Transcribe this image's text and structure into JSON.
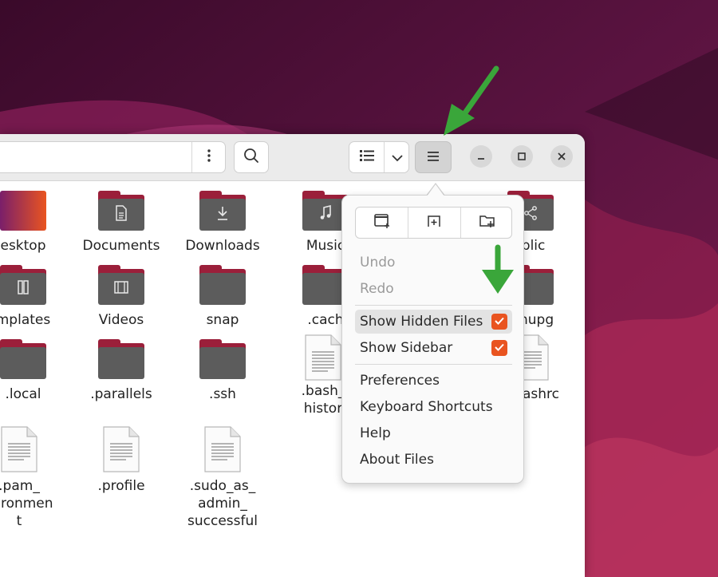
{
  "colors": {
    "accent": "#e95420",
    "folder_front": "#5c5c5c",
    "folder_back": "#9b1f3a",
    "annotation_arrow": "#3aa63a"
  },
  "headerbar": {
    "path_menu_icon": "vertical-ellipsis-icon",
    "search_icon": "search-icon",
    "view_icon": "list-view-icon",
    "view_dropdown_icon": "chevron-down-icon",
    "main_menu_icon": "hamburger-menu-icon",
    "window_controls": [
      "minimize",
      "maximize",
      "close"
    ]
  },
  "files": [
    {
      "label": "esktop",
      "kind": "folder-desktop"
    },
    {
      "label": "Documents",
      "kind": "folder",
      "icon": "document-icon"
    },
    {
      "label": "Downloads",
      "kind": "folder",
      "icon": "download-icon"
    },
    {
      "label": "Music",
      "kind": "folder",
      "icon": "music-icon"
    },
    {
      "label": "ublic",
      "kind": "folder",
      "icon": "share-icon"
    },
    {
      "label": "mplates",
      "kind": "folder",
      "icon": "template-icon"
    },
    {
      "label": "Videos",
      "kind": "folder",
      "icon": "video-icon"
    },
    {
      "label": "snap",
      "kind": "folder"
    },
    {
      "label": ".cach",
      "kind": "folder"
    },
    {
      "label": "nupg",
      "kind": "folder"
    },
    {
      "label": ".local",
      "kind": "folder"
    },
    {
      "label": ".parallels",
      "kind": "folder"
    },
    {
      "label": ".ssh",
      "kind": "folder"
    },
    {
      "label": ".bash_",
      "label2": "histor",
      "kind": "doc"
    },
    {
      "label": "ashrc",
      "kind": "doc"
    },
    {
      "label": ".pam_",
      "label2": "ivironmen",
      "label3": "t",
      "kind": "doc"
    },
    {
      "label": ".profile",
      "kind": "doc"
    },
    {
      "label": ".sudo_as_",
      "label2": "admin_",
      "label3": "successful",
      "kind": "doc"
    }
  ],
  "menu": {
    "new_buttons": [
      {
        "name": "new-window-button",
        "icon": "new-window-icon"
      },
      {
        "name": "new-tab-button",
        "icon": "new-tab-icon"
      },
      {
        "name": "new-folder-button",
        "icon": "new-folder-icon"
      }
    ],
    "undo": "Undo",
    "redo": "Redo",
    "show_hidden_files": "Show Hidden Files",
    "show_hidden_files_checked": true,
    "show_sidebar": "Show Sidebar",
    "show_sidebar_checked": true,
    "preferences": "Preferences",
    "keyboard_shortcuts": "Keyboard Shortcuts",
    "help": "Help",
    "about_files": "About Files"
  }
}
